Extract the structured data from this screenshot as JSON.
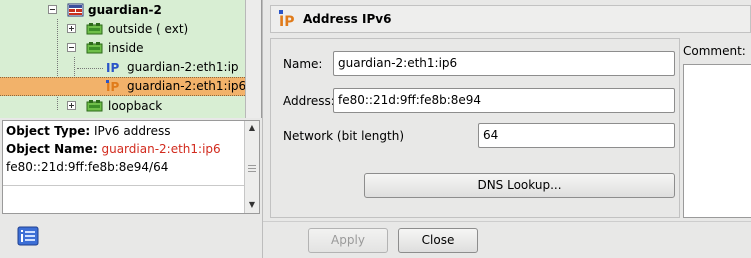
{
  "tree": {
    "items": [
      {
        "label": "guardian-2",
        "icon": "firewall-icon",
        "toggle": "expanded",
        "selected": false
      },
      {
        "label": "outside ( ext)",
        "icon": "interface-icon",
        "toggle": "collapsed",
        "selected": false
      },
      {
        "label": "inside",
        "icon": "interface-icon",
        "toggle": "expanded",
        "selected": false
      },
      {
        "label": "guardian-2:eth1:ip",
        "icon": "ip-address-icon",
        "toggle": "none",
        "selected": false
      },
      {
        "label": "guardian-2:eth1:ip6",
        "icon": "ipv6-address-icon",
        "toggle": "none",
        "selected": true
      },
      {
        "label": "loopback",
        "icon": "interface-icon",
        "toggle": "collapsed",
        "selected": false
      }
    ]
  },
  "info": {
    "type_label": "Object Type:",
    "type_value": "IPv6 address",
    "name_label": "Object Name:",
    "name_value": "guardian-2:eth1:ip6",
    "address_line": "fe80::21d:9ff:fe8b:8e94/64",
    "name_color": "#d22b1e"
  },
  "editor": {
    "title": "Address IPv6",
    "icon": "ipv6-icon",
    "name_label": "Name:",
    "name_value": "guardian-2:eth1:ip6",
    "address_label": "Address:",
    "address_value": "fe80::21d:9ff:fe8b:8e94",
    "network_label": "Network (bit length)",
    "network_value": "64",
    "dns_button": "DNS Lookup...",
    "comment_label": "Comment:",
    "comment_value": ""
  },
  "buttons": {
    "apply": "Apply",
    "close": "Close"
  },
  "colors": {
    "tree_bg": "#d8eed3",
    "selection": "#f2b26a",
    "accent_orange": "#e07b1a",
    "ip_blue": "#2a55c8"
  }
}
